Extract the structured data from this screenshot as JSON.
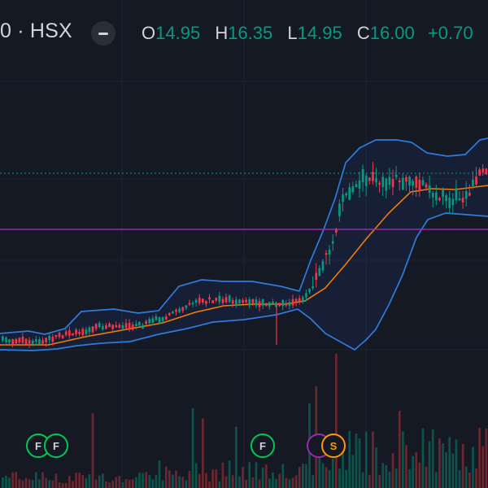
{
  "window": {
    "background": "#151924"
  },
  "header": {
    "symbol": "0 · HSX",
    "collapse_icon": "minus-icon",
    "ohlc": {
      "open_label": "O",
      "open": "14.95",
      "high_label": "H",
      "high": "16.35",
      "low_label": "L",
      "low": "14.95",
      "close_label": "C",
      "close": "16.00",
      "change": "+0.70"
    }
  },
  "colors": {
    "up": "#089981",
    "down": "#f23645",
    "bollinger": "#2962ff",
    "basis": "#ff6d00",
    "horizontal_line": "#9c27b0",
    "dotted_line": "#089981",
    "event_f": "#00c853",
    "event_s": "#ff9800",
    "event_p": "#9c27b0",
    "text": "#d1d4dc"
  },
  "events": [
    {
      "label": "F",
      "type": "f"
    },
    {
      "label": "F",
      "type": "f"
    },
    {
      "label": "F",
      "type": "f"
    },
    {
      "label": "",
      "type": "p"
    },
    {
      "label": "S",
      "type": "s"
    }
  ]
}
